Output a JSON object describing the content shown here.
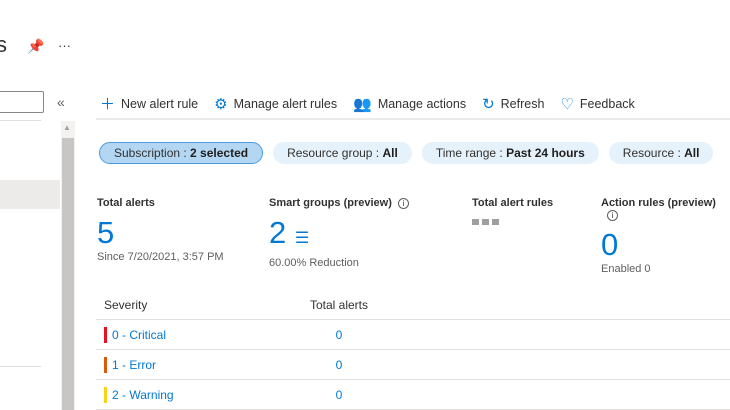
{
  "header": {
    "title": "s",
    "pin_icon": "pin-icon",
    "more": "···"
  },
  "sidebar": {
    "collapse": "«"
  },
  "toolbar": {
    "new_alert_rule": "New alert rule",
    "manage_alert_rules": "Manage alert rules",
    "manage_actions": "Manage actions",
    "refresh": "Refresh",
    "feedback": "Feedback"
  },
  "filters": [
    {
      "label": "Subscription : ",
      "value": "2 selected"
    },
    {
      "label": "Resource group : ",
      "value": "All"
    },
    {
      "label": "Time range : ",
      "value": "Past 24 hours"
    },
    {
      "label": "Resource : ",
      "value": "All"
    }
  ],
  "cards": {
    "total_alerts": {
      "title": "Total alerts",
      "value": "5",
      "sub": "Since 7/20/2021, 3:57 PM"
    },
    "smart_groups": {
      "title": "Smart groups (preview)",
      "value": "2",
      "sub": "60.00% Reduction"
    },
    "total_alert_rules": {
      "title": "Total alert rules"
    },
    "action_rules": {
      "title": "Action rules (preview)",
      "value": "0",
      "sub": "Enabled 0"
    }
  },
  "table": {
    "headers": [
      "Severity",
      "Total alerts"
    ],
    "rows": [
      {
        "severity": "0 - Critical",
        "total": "0",
        "color": "#e81123"
      },
      {
        "severity": "1 - Error",
        "total": "0",
        "color": "#d9590f"
      },
      {
        "severity": "2 - Warning",
        "total": "0",
        "color": "#fcd116"
      }
    ]
  }
}
